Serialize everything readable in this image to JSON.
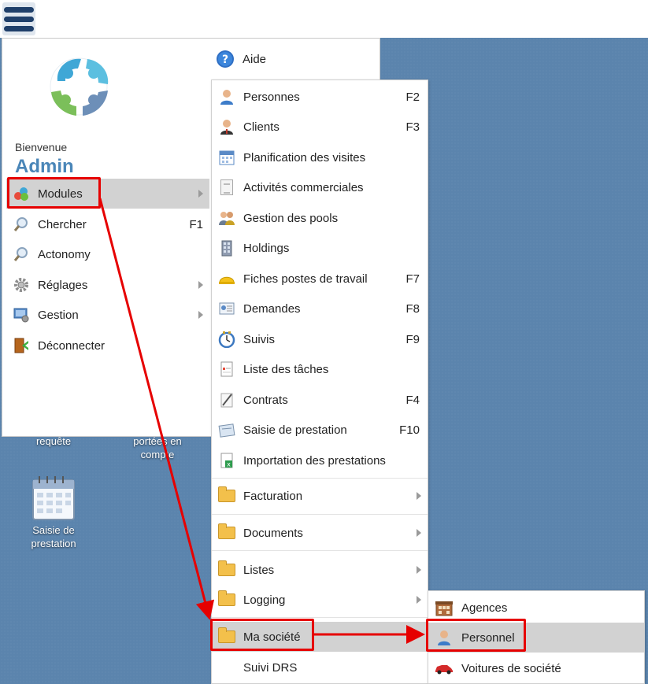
{
  "topbar": {
    "menu_icon": "hamburger-icon"
  },
  "desktop": {
    "icons": [
      {
        "label": "requête",
        "icon": "query-icon"
      },
      {
        "label": "portées en compte",
        "icon": "account-icon"
      },
      {
        "label": "Saisie de prestation",
        "icon": "calendar-icon"
      }
    ]
  },
  "panel": {
    "welcome": "Bienvenue",
    "user": "Admin",
    "aide": "Aide",
    "items": [
      {
        "label": "Modules",
        "icon": "modules-icon",
        "shortcut": "",
        "submenu": true
      },
      {
        "label": "Chercher",
        "icon": "search-icon",
        "shortcut": "F1",
        "submenu": false
      },
      {
        "label": "Actonomy",
        "icon": "search-icon",
        "shortcut": "",
        "submenu": false
      },
      {
        "label": "Réglages",
        "icon": "gear-icon",
        "shortcut": "",
        "submenu": true
      },
      {
        "label": "Gestion",
        "icon": "management-icon",
        "shortcut": "",
        "submenu": true
      },
      {
        "label": "Déconnecter",
        "icon": "logout-icon",
        "shortcut": "",
        "submenu": false
      }
    ]
  },
  "modules": {
    "items": [
      {
        "label": "Personnes",
        "shortcut": "F2",
        "icon": "person-icon"
      },
      {
        "label": "Clients",
        "shortcut": "F3",
        "icon": "client-icon"
      },
      {
        "label": "Planification des visites",
        "shortcut": "",
        "icon": "calendar-icon"
      },
      {
        "label": "Activités commerciales",
        "shortcut": "",
        "icon": "document-icon"
      },
      {
        "label": "Gestion des pools",
        "shortcut": "",
        "icon": "group-icon"
      },
      {
        "label": "Holdings",
        "shortcut": "",
        "icon": "building-icon"
      },
      {
        "label": "Fiches postes de travail",
        "shortcut": "F7",
        "icon": "helmet-icon"
      },
      {
        "label": "Demandes",
        "shortcut": "F8",
        "icon": "request-icon"
      },
      {
        "label": "Suivis",
        "shortcut": "F9",
        "icon": "clock-icon"
      },
      {
        "label": "Liste des tâches",
        "shortcut": "",
        "icon": "task-list-icon"
      },
      {
        "label": "Contrats",
        "shortcut": "F4",
        "icon": "contract-icon"
      },
      {
        "label": "Saisie de prestation",
        "shortcut": "F10",
        "icon": "prestation-icon"
      },
      {
        "label": "Importation des prestations",
        "shortcut": "",
        "icon": "import-icon"
      }
    ],
    "folders": [
      {
        "label": "Facturation"
      },
      {
        "label": "Documents"
      },
      {
        "label": "Listes"
      },
      {
        "label": "Logging"
      },
      {
        "label": "Ma société"
      }
    ],
    "last": "Suivi DRS"
  },
  "societe": {
    "items": [
      {
        "label": "Agences",
        "icon": "agency-icon"
      },
      {
        "label": "Personnel",
        "icon": "person-icon"
      },
      {
        "label": "Voitures de société",
        "icon": "car-icon"
      }
    ]
  },
  "colors": {
    "desktop": "#5b84ad",
    "highlight": "#e60000",
    "admin": "#4a86b8",
    "active_row": "#d2d2d2"
  }
}
